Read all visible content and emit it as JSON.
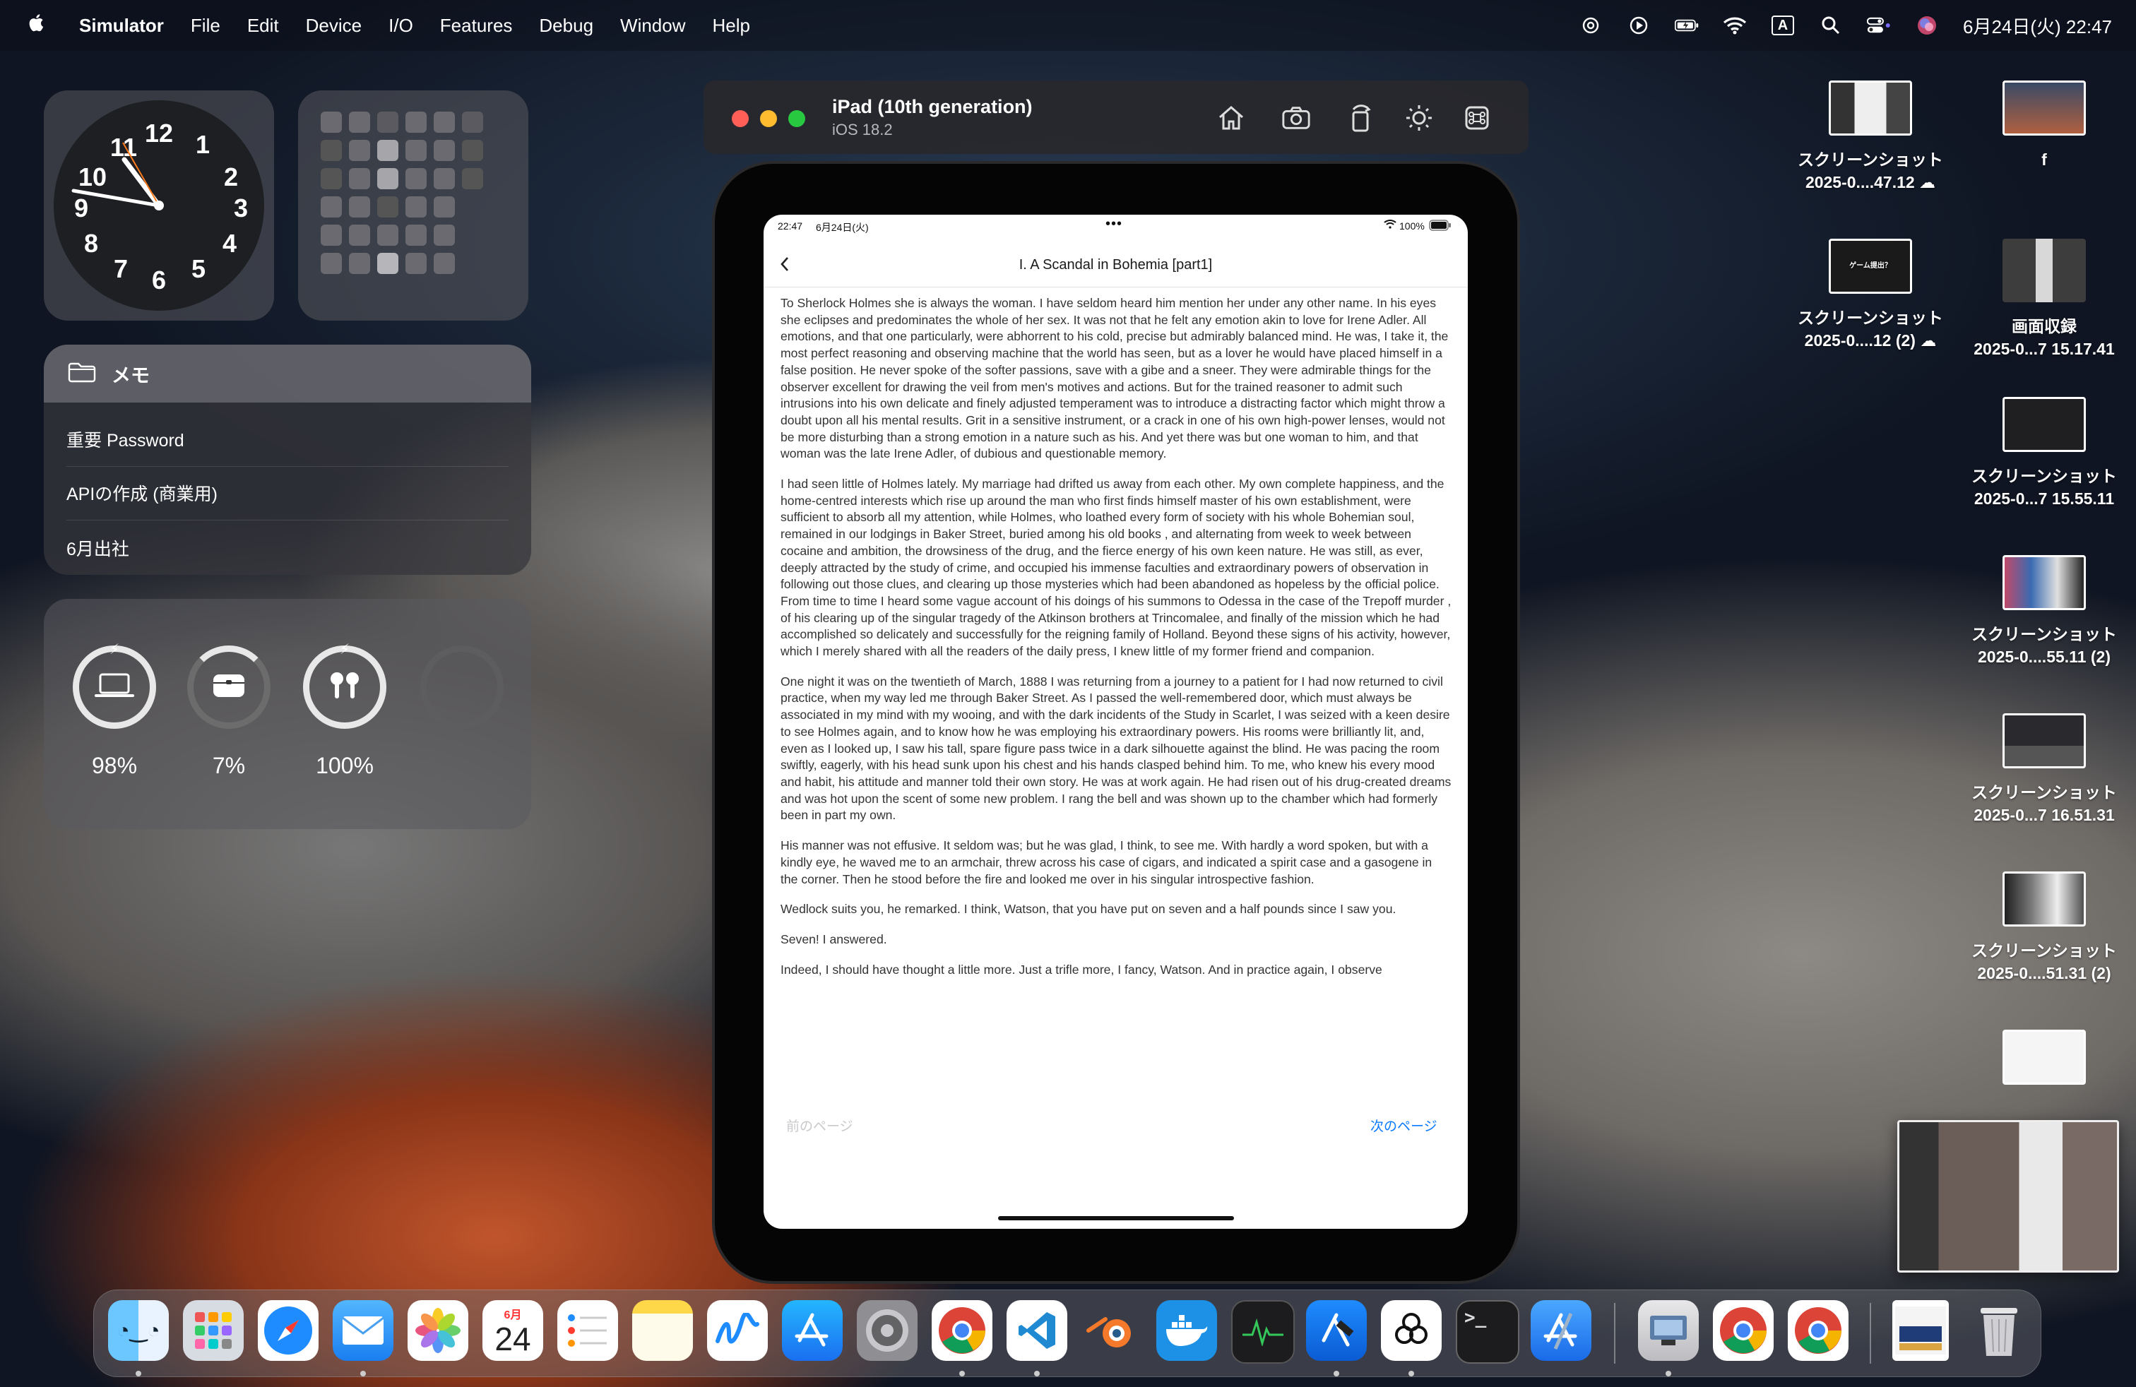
{
  "menubar": {
    "app_name": "Simulator",
    "menus": [
      "File",
      "Edit",
      "Device",
      "I/O",
      "Features",
      "Debug",
      "Window",
      "Help"
    ],
    "datetime": "6月24日(火) 22:47",
    "input_mode": "A"
  },
  "widgets": {
    "notes": {
      "title": "メモ",
      "items": [
        "重要 Password",
        "APIの作成 (商業用)",
        "6月出社"
      ]
    },
    "batteries": [
      {
        "label": "98%",
        "icon": "laptop-icon",
        "level": 0.98
      },
      {
        "label": "7%",
        "icon": "airpods-case-icon",
        "level": 0.07
      },
      {
        "label": "100%",
        "icon": "airpods-icon",
        "level": 1.0
      },
      {
        "label": "",
        "icon": "empty-slot",
        "level": 0
      }
    ],
    "clock_numbers": [
      "12",
      "1",
      "2",
      "3",
      "4",
      "5",
      "6",
      "7",
      "8",
      "9",
      "10",
      "11"
    ]
  },
  "simulator": {
    "device_name": "iPad (10th generation)",
    "os": "iOS 18.2"
  },
  "ipad": {
    "status_time": "22:47",
    "status_date": "6月24日(火)",
    "battery": "100%",
    "nav_title": "I. A Scandal in Bohemia [part1]",
    "paragraphs": [
      "To Sherlock Holmes she is always the woman. I have seldom heard him mention her under any other name. In his eyes she eclipses and predominates the whole of her sex. It was not that he felt any emotion akin to love for Irene Adler. All emotions, and that one particularly, were abhorrent to his cold, precise but admirably balanced mind. He was, I take it, the most perfect reasoning and observing machine that the world has seen, but as a lover he would have placed himself in a false position. He never spoke of the softer passions, save with a gibe and a sneer. They were admirable things for the observer excellent for drawing the veil from men's motives and actions. But for the trained reasoner to admit such intrusions into his own delicate and finely adjusted temperament was to introduce a distracting factor which might throw a doubt upon all his mental results. Grit in a sensitive instrument, or a crack in one of his own high-power lenses, would not be more disturbing than a strong emotion in a nature such as his. And yet there was but one woman to him, and that woman was the late Irene Adler, of dubious and questionable memory.",
      "I had seen little of Holmes lately. My marriage had drifted us away from each other. My own complete happiness, and the home-centred interests which rise up around the man who first finds himself master of his own establishment, were sufficient to absorb all my attention, while Holmes, who loathed every form of society with his whole Bohemian soul, remained in our lodgings in Baker Street, buried among his old books , and alternating from week to week between cocaine and ambition, the drowsiness of the drug, and the fierce energy of his own keen nature. He was still, as ever, deeply attracted by the study of crime, and occupied his immense faculties and extraordinary powers of observation in following out those clues, and clearing up those mysteries which had been abandoned as hopeless by the official police. From time to time I heard some vague account of his doings of his summons to Odessa in the case of the Trepoff murder , of his clearing up of the singular tragedy of the Atkinson brothers at Trincomalee, and finally of the mission which he had accomplished so delicately and successfully for the reigning family of Holland. Beyond these signs of his activity, however, which I merely shared with all the readers of the daily press, I knew little of my former friend and companion.",
      "One night it was on the twentieth of March, 1888 I was returning from a journey to a patient for I had now returned to civil practice, when my way led me through Baker Street. As I passed the well-remembered door, which must always be associated in my mind with my wooing, and with the dark incidents of the Study in Scarlet, I was seized with a keen desire to see Holmes again, and to know how he was employing his extraordinary powers. His rooms were brilliantly lit, and, even as I looked up, I saw his tall, spare figure pass twice in a dark silhouette against the blind. He was pacing the room swiftly, eagerly, with his head sunk upon his chest and his hands clasped behind him. To me, who knew his every mood and habit, his attitude and manner told their own story. He was at work again. He had risen out of his drug-created dreams and was hot upon the scent of some new problem. I rang the bell and was shown up to the chamber which had formerly been in part my own.",
      "His manner was not effusive. It seldom was; but he was glad, I think, to see me. With hardly a word spoken, but with a kindly eye, he waved me to an armchair, threw across his case of cigars, and indicated a spirit case and a gasogene in the corner. Then he stood before the fire and looked me over in his singular introspective fashion.",
      "Wedlock suits you, he remarked. I think, Watson, that you have put on seven and a half pounds since I saw you.",
      "Seven! I answered.",
      "Indeed, I should have thought a little more. Just a trifle more, I fancy, Watson. And in practice again, I observe"
    ],
    "prev_page": "前のページ",
    "next_page": "次のページ"
  },
  "desktop_icons": [
    {
      "line1": "スクリーンショット",
      "line2": "2025-0....47.12 ☁"
    },
    {
      "line1": "f",
      "line2": ""
    },
    {
      "line1": "スクリーンショット",
      "line2": "2025-0....12 (2) ☁"
    },
    {
      "line1": "画面収録",
      "line2": "2025-0...7 15.17.41"
    },
    {
      "line1": "スクリーンショット",
      "line2": "2025-0...7 15.55.11"
    },
    {
      "line1": "スクリーンショット",
      "line2": "2025-0....55.11 (2)"
    },
    {
      "line1": "スクリーンショット",
      "line2": "2025-0...7 16.51.31"
    },
    {
      "line1": "スクリーンショット",
      "line2": "2025-0....51.31 (2)"
    }
  ],
  "dock": {
    "calendar_month": "6月",
    "calendar_day": "24",
    "apps": [
      "finder",
      "launchpad",
      "safari",
      "mail",
      "photos",
      "calendar",
      "reminders",
      "notes",
      "freeform",
      "app-store",
      "system-settings",
      "chrome",
      "vscode",
      "blender",
      "docker",
      "activity-monitor",
      "xcode-instruments",
      "chatgpt",
      "terminal",
      "xcode",
      "preview",
      "chrome-2",
      "chrome-3",
      "downloads",
      "trash"
    ]
  },
  "colors": {
    "accent": "#0a7aff",
    "close": "#ff5f57",
    "minimize": "#febc2e",
    "zoom": "#28c840"
  }
}
